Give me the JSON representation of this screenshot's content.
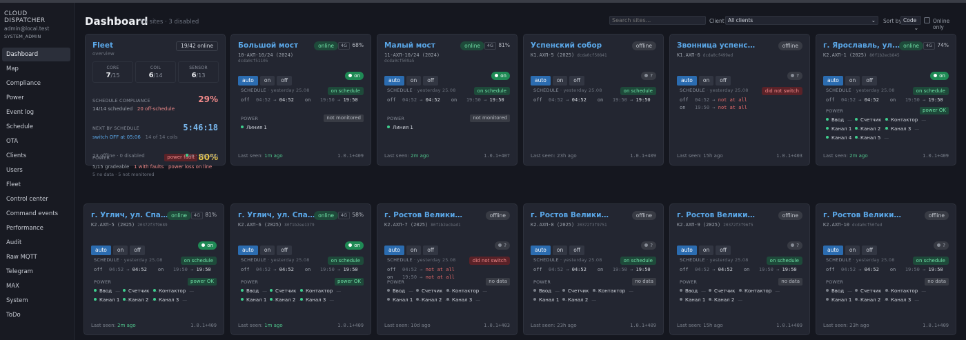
{
  "sidebar": {
    "brand": "CLOUD DISPATCHER",
    "user": "admin@local.test",
    "role": "SYSTEM_ADMIN",
    "items": [
      "Dashboard",
      "Map",
      "Compliance",
      "Power",
      "Event log",
      "Schedule",
      "OTA",
      "Clients",
      "Users",
      "Fleet",
      "Control center",
      "Command events",
      "Performance",
      "Audit",
      "Raw MQTT",
      "Telegram",
      "MAX",
      "System",
      "ToDo"
    ]
  },
  "header": {
    "title": "Dashboard",
    "sub": "15 sites · 3 disabled",
    "search_placeholder": "Search sites...",
    "client_label": "Client",
    "client_value": "All clients",
    "sort_label": "Sort by",
    "sort_value": "Code",
    "online_only": "Online only"
  },
  "fleet": {
    "title": "Fleet",
    "overview": "overview",
    "online": "19/42 online",
    "core_k": "CORE",
    "core_v": "7",
    "core_t": "/15",
    "coil_k": "COIL",
    "coil_v": "6",
    "coil_t": "/14",
    "sensor_k": "SENSOR",
    "sensor_v": "6",
    "sensor_t": "/13",
    "sc_label": "SCHEDULE COMPLIANCE",
    "sc_value": "29%",
    "sc_a": "14/14 scheduled",
    "sc_b": "20 off-schedule",
    "nx_label": "NEXT BY SCHEDULE",
    "nx_value": "5:46:18",
    "nx_a": "switch OFF at 05:06",
    "nx_b": "14 of 14 coils",
    "pw_label": "POWER",
    "pw_badge": "power fault",
    "pw_value": "80%",
    "pw_a": "5/15 gradeable",
    "pw_b": "1 with faults",
    "pw_c": "power loss on line",
    "pw_d": "5 no data · 5 not monitored",
    "foot_a": "23 offline · 0 disabled",
    "foot_b": "live · 10s ago"
  },
  "sites": [
    {
      "title": "Большой мост",
      "code": "10-АХП-10/24 (2024)",
      "mac": "",
      "code2": "dcda0cf51105",
      "status": "online",
      "net": "4G",
      "pct": "68%",
      "ind": "on",
      "sched": "on schedule",
      "r1": [
        "off",
        "04:52",
        "04:52",
        "on",
        "19:50",
        "19:50"
      ],
      "r2": null,
      "power_badge": "not monitored",
      "power_items": [
        [
          "Линия 1",
          "g"
        ]
      ],
      "seen": "1m ago",
      "ver": "1.0.1+409"
    },
    {
      "title": "Малый мост",
      "code": "11-АХП-10/24 (2024)",
      "mac": "",
      "code2": "dcda0cf509a5",
      "status": "online",
      "net": "4G",
      "pct": "81%",
      "ind": "on",
      "sched": "on schedule",
      "r1": [
        "off",
        "04:52",
        "04:52",
        "on",
        "19:50",
        "19:50"
      ],
      "r2": null,
      "power_badge": "not monitored",
      "power_items": [
        [
          "Линия 1",
          "g"
        ]
      ],
      "seen": "2m ago",
      "ver": "1.0.1+407"
    },
    {
      "title": "Успенский собор",
      "code": "К1.АХП-5 (2025)",
      "mac": "dcda0cf50841",
      "code2": "",
      "status": "offline",
      "net": "",
      "pct": "",
      "ind": "?",
      "sched": "on schedule",
      "r1": [
        "off",
        "04:52",
        "04:52",
        "on",
        "19:50",
        "19:50"
      ],
      "r2": null,
      "power_badge": "",
      "power_items": [],
      "seen": "23h ago",
      "ver": "1.0.1+409"
    },
    {
      "title": "Звонница успенского собора",
      "code": "К1.АХП-6",
      "mac": "dcda0cf499ed",
      "code2": "",
      "status": "offline",
      "net": "",
      "pct": "",
      "ind": "?",
      "sched": "did not switch",
      "r1": [
        "off",
        "04:52",
        "not at all"
      ],
      "r2": [
        "on",
        "19:50",
        "not at all"
      ],
      "power_badge": "",
      "power_items": [],
      "seen": "15h ago",
      "ver": "1.0.1+403"
    },
    {
      "title": "г. Ярославль, ул. Пер...",
      "code": "К2.АХП-1 (2025)",
      "mac": "80f1b2ecb845",
      "code2": "",
      "status": "online",
      "net": "4G",
      "pct": "74%",
      "ind": "on",
      "sched": "on schedule",
      "r1": [
        "off",
        "04:52",
        "04:52",
        "on",
        "19:50",
        "19:50"
      ],
      "r2": null,
      "power_badge": "power OK",
      "power_items": [
        [
          "Ввод",
          "g"
        ],
        [
          "Счетчик",
          "g"
        ],
        [
          "Контактор",
          "g"
        ],
        [
          "Канал 1",
          "g"
        ],
        [
          "Канал 2",
          "g"
        ],
        [
          "Канал 3",
          "g"
        ],
        [
          "Канал 4",
          "g"
        ],
        [
          "Канал 5",
          "g"
        ]
      ],
      "seen": "2m ago",
      "ver": "1.0.1+409"
    },
    {
      "title": "г. Углич, ул. Спасская ...",
      "code": "К2.АХП-5 (2025)",
      "mac": "20372f3f9689",
      "code2": "",
      "status": "online",
      "net": "4G",
      "pct": "81%",
      "ind": "on",
      "sched": "on schedule",
      "r1": [
        "off",
        "04:52",
        "04:52",
        "on",
        "19:50",
        "19:50"
      ],
      "r2": null,
      "power_badge": "power OK",
      "power_items": [
        [
          "Ввод",
          "g"
        ],
        [
          "Счетчик",
          "g"
        ],
        [
          "Контактор",
          "g"
        ],
        [
          "Канал 1",
          "g"
        ],
        [
          "Канал 2",
          "g"
        ],
        [
          "Канал 3",
          "g"
        ]
      ],
      "seen": "2m ago",
      "ver": "1.0.1+409"
    },
    {
      "title": "г. Углич, ул. Спасская ...",
      "code": "К2.АХП-6 (2025)",
      "mac": "80f1b2ee1379",
      "code2": "",
      "status": "online",
      "net": "4G",
      "pct": "58%",
      "ind": "on",
      "sched": "on schedule",
      "r1": [
        "off",
        "04:52",
        "04:52",
        "on",
        "19:50",
        "19:50"
      ],
      "r2": null,
      "power_badge": "power OK",
      "power_items": [
        [
          "Ввод",
          "g"
        ],
        [
          "Счетчик",
          "g"
        ],
        [
          "Контактор",
          "g"
        ],
        [
          "Канал 1",
          "g"
        ],
        [
          "Канал 2",
          "g"
        ],
        [
          "Канал 3",
          "g"
        ]
      ],
      "seen": "1m ago",
      "ver": "1.0.1+409"
    },
    {
      "title": "г. Ростов Великий, ул. Советс...",
      "code": "К2.АХП-7 (2025)",
      "mac": "80f1b2ecbad1",
      "code2": "",
      "status": "offline",
      "net": "",
      "pct": "",
      "ind": "?",
      "sched": "did not switch",
      "r1": [
        "off",
        "04:52",
        "not at all"
      ],
      "r2": [
        "on",
        "19:50",
        "not at all"
      ],
      "power_badge": "no data",
      "power_items": [
        [
          "Ввод",
          "x"
        ],
        [
          "Счетчик",
          "x"
        ],
        [
          "Контактор",
          "x"
        ],
        [
          "Канал 1",
          "x"
        ],
        [
          "Канал 2",
          "x"
        ],
        [
          "Канал 3",
          "x"
        ]
      ],
      "seen": "10d ago",
      "ver": "1.0.1+403"
    },
    {
      "title": "г. Ростов Великий, ул. Советс...",
      "code": "К2.АХП-8 (2025)",
      "mac": "20372f3f9751",
      "code2": "",
      "status": "offline",
      "net": "",
      "pct": "",
      "ind": "?",
      "sched": "on schedule",
      "r1": [
        "off",
        "04:52",
        "04:52",
        "on",
        "19:50",
        "19:50"
      ],
      "r2": null,
      "power_badge": "no data",
      "power_items": [
        [
          "Ввод",
          "x"
        ],
        [
          "Счетчик",
          "x"
        ],
        [
          "Контактор",
          "x"
        ],
        [
          "Канал 1",
          "x"
        ],
        [
          "Канал 2",
          "x"
        ]
      ],
      "seen": "23h ago",
      "ver": "1.0.1+409"
    },
    {
      "title": "г. Ростов Великий, ул. Советс...",
      "code": "К2.АХП-9 (2025)",
      "mac": "20372f3f96f5",
      "code2": "",
      "status": "offline",
      "net": "",
      "pct": "",
      "ind": "?",
      "sched": "on schedule",
      "r1": [
        "off",
        "04:52",
        "04:52",
        "on",
        "19:50",
        "19:50"
      ],
      "r2": null,
      "power_badge": "no data",
      "power_items": [
        [
          "Ввод",
          "x"
        ],
        [
          "Счетчик",
          "x"
        ],
        [
          "Контактор",
          "x"
        ],
        [
          "Канал 1",
          "x"
        ],
        [
          "Канал 2",
          "x"
        ]
      ],
      "seen": "15h ago",
      "ver": "1.0.1+409"
    },
    {
      "title": "г. Ростов Великий, ул. Советс...",
      "code": "К2.АХП-10",
      "mac": "dcda0cf50fed",
      "code2": "",
      "status": "offline",
      "net": "",
      "pct": "",
      "ind": "?",
      "sched": "on schedule",
      "r1": [
        "off",
        "04:52",
        "04:52",
        "on",
        "19:50",
        "19:50"
      ],
      "r2": null,
      "power_badge": "no data",
      "power_items": [
        [
          "Ввод",
          "x"
        ],
        [
          "Счетчик",
          "x"
        ],
        [
          "Контактор",
          "x"
        ],
        [
          "Канал 1",
          "x"
        ],
        [
          "Канал 2",
          "x"
        ],
        [
          "Канал 3",
          "x"
        ]
      ],
      "seen": "23h ago",
      "ver": "1.0.1+409"
    }
  ],
  "labels": {
    "auto": "auto",
    "on": "on",
    "off": "off",
    "schedule": "SCHEDULE",
    "schedule_when": "· yesterday 25.08",
    "power": "POWER",
    "last_seen": "Last seen:",
    "arrow": "→",
    "dash": "—"
  }
}
